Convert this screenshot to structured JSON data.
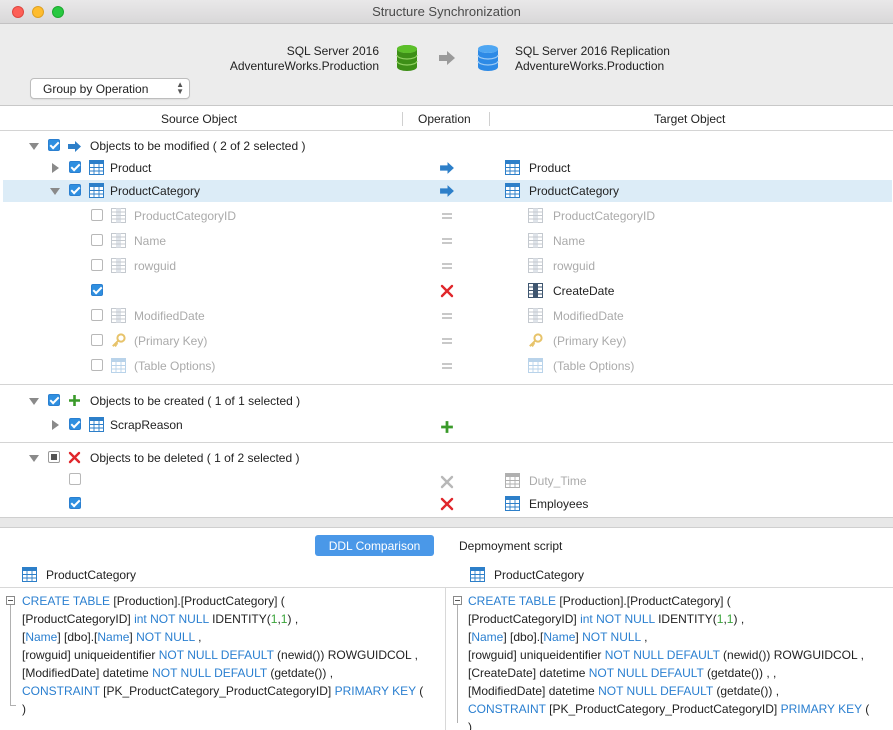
{
  "window": {
    "title": "Structure Synchronization"
  },
  "source": {
    "server": "SQL Server 2016",
    "database": "AdventureWorks.Production"
  },
  "target": {
    "server": "SQL Server 2016 Replication",
    "database": "AdventureWorks.Production"
  },
  "group_select": {
    "value": "Group by Operation"
  },
  "columns": {
    "source": "Source Object",
    "operation": "Operation",
    "target": "Target Object"
  },
  "groups": {
    "modified": {
      "label": "Objects to be modified",
      "count": "( 2 of 2 selected )"
    },
    "created": {
      "label": "Objects to be created",
      "count": "( 1 of 1 selected )"
    },
    "deleted": {
      "label": "Objects to be deleted",
      "count": "( 1 of 2 selected )"
    }
  },
  "rows": {
    "product": {
      "source": "Product",
      "target": "Product"
    },
    "productcategory": {
      "source": "ProductCategory",
      "target": "ProductCategory"
    },
    "col1": {
      "source": "ProductCategoryID",
      "target": "ProductCategoryID"
    },
    "col2": {
      "source": "Name",
      "target": "Name"
    },
    "col3": {
      "source": "rowguid",
      "target": "rowguid"
    },
    "col4": {
      "source": "",
      "target": "CreateDate"
    },
    "col5": {
      "source": "ModifiedDate",
      "target": "ModifiedDate"
    },
    "col6": {
      "source": "(Primary Key)",
      "target": "(Primary Key)"
    },
    "col7": {
      "source": "(Table Options)",
      "target": "(Table Options)"
    },
    "scrapreason": {
      "source": "ScrapReason",
      "target": ""
    },
    "dutytime": {
      "source": "",
      "target": "Duty_Time"
    },
    "employees": {
      "source": "",
      "target": "Employees"
    }
  },
  "tabs": {
    "ddl": "DDL Comparison",
    "deploy": "Depmoyment script"
  },
  "ddl": {
    "left_title": "ProductCategory",
    "right_title": "ProductCategory"
  },
  "colors": {
    "accent": "#2f8fe0",
    "keyword": "#2a7fd0",
    "remove": "#e0262b",
    "add": "#3a9a2a",
    "selection": "#dcecf7"
  }
}
